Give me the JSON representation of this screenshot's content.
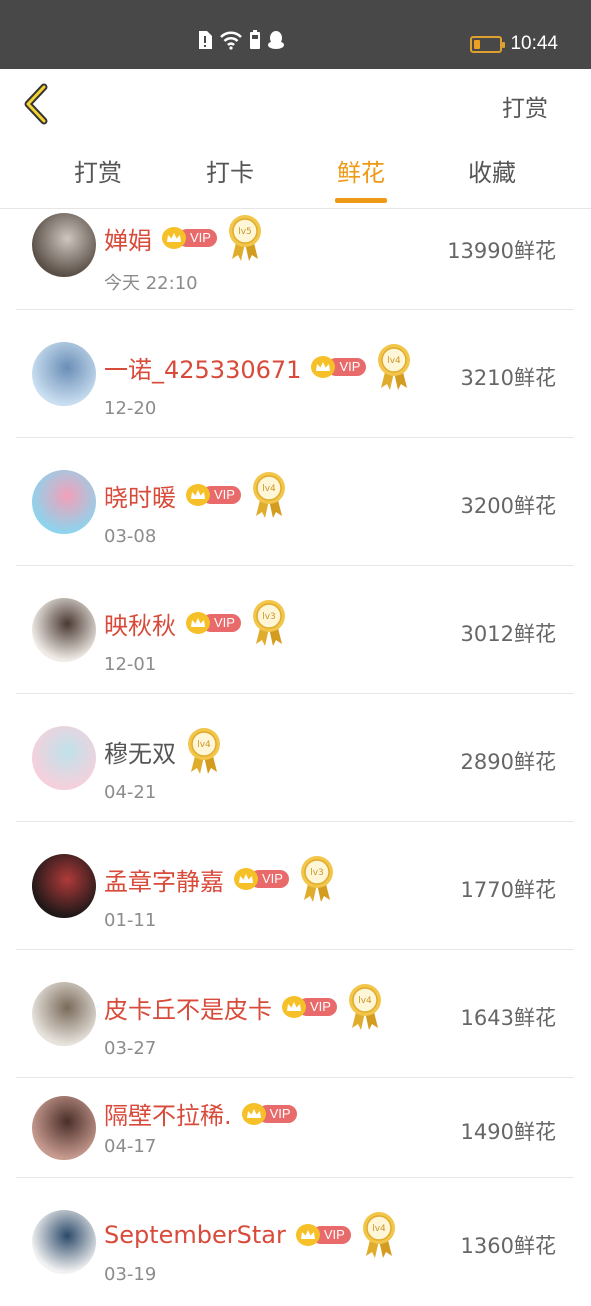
{
  "status_bar": {
    "time": "10:44",
    "icons": [
      "alert-icon",
      "wifi-icon",
      "battery-small-icon",
      "qq-icon"
    ],
    "battery_level": 0.2
  },
  "header": {
    "back_icon": "chevron-left-icon",
    "action_label": "打赏"
  },
  "tabs": [
    {
      "label": "打赏",
      "active": false
    },
    {
      "label": "打卡",
      "active": false
    },
    {
      "label": "鲜花",
      "active": true
    },
    {
      "label": "收藏",
      "active": false
    }
  ],
  "vip_label": "VIP",
  "colors": {
    "accent": "#ef9a16",
    "vip_name": "#d84a3a",
    "vip_badge": "#e86a6a",
    "crown": "#f6c028",
    "medal": "#e0ac2c",
    "status_bar": "#484848"
  },
  "rows": [
    {
      "name": "婵娟",
      "vip": true,
      "level": "lv5",
      "date": "今天 22:10",
      "amount": "13990鲜花",
      "avatar": [
        "#5a5048",
        "#cfc6bf"
      ]
    },
    {
      "name": "一诺_425330671",
      "vip": true,
      "level": "lv4",
      "date": "12-20",
      "amount": "3210鲜花",
      "avatar": [
        "#c9def0",
        "#6a8eb6"
      ]
    },
    {
      "name": "晓时暖",
      "vip": true,
      "level": "lv4",
      "date": "03-08",
      "amount": "3200鲜花",
      "avatar": [
        "#8ed3ec",
        "#f3a0b8"
      ]
    },
    {
      "name": "映秋秋",
      "vip": true,
      "level": "lv3",
      "date": "12-01",
      "amount": "3012鲜花",
      "avatar": [
        "#f0ebe6",
        "#4a3a32"
      ]
    },
    {
      "name": "穆无双",
      "vip": false,
      "level": "lv4",
      "date": "04-21",
      "amount": "2890鲜花",
      "avatar": [
        "#f5d0dc",
        "#bfe2ea"
      ]
    },
    {
      "name": "孟章字静嘉",
      "vip": true,
      "level": "lv3",
      "date": "01-11",
      "amount": "1770鲜花",
      "avatar": [
        "#201818",
        "#b03a3a"
      ]
    },
    {
      "name": "皮卡丘不是皮卡",
      "vip": true,
      "level": "lv4",
      "date": "03-27",
      "amount": "1643鲜花",
      "avatar": [
        "#e6e2dc",
        "#7a6a5a"
      ]
    },
    {
      "name": "隔壁不拉稀.",
      "vip": true,
      "level": "",
      "date": "04-17",
      "amount": "1490鲜花",
      "avatar": [
        "#c79a8e",
        "#4a2f2a"
      ]
    },
    {
      "name": "SeptemberStar",
      "vip": true,
      "level": "lv4",
      "date": "03-19",
      "amount": "1360鲜花",
      "avatar": [
        "#f2f2f2",
        "#2c4a6a"
      ]
    }
  ]
}
